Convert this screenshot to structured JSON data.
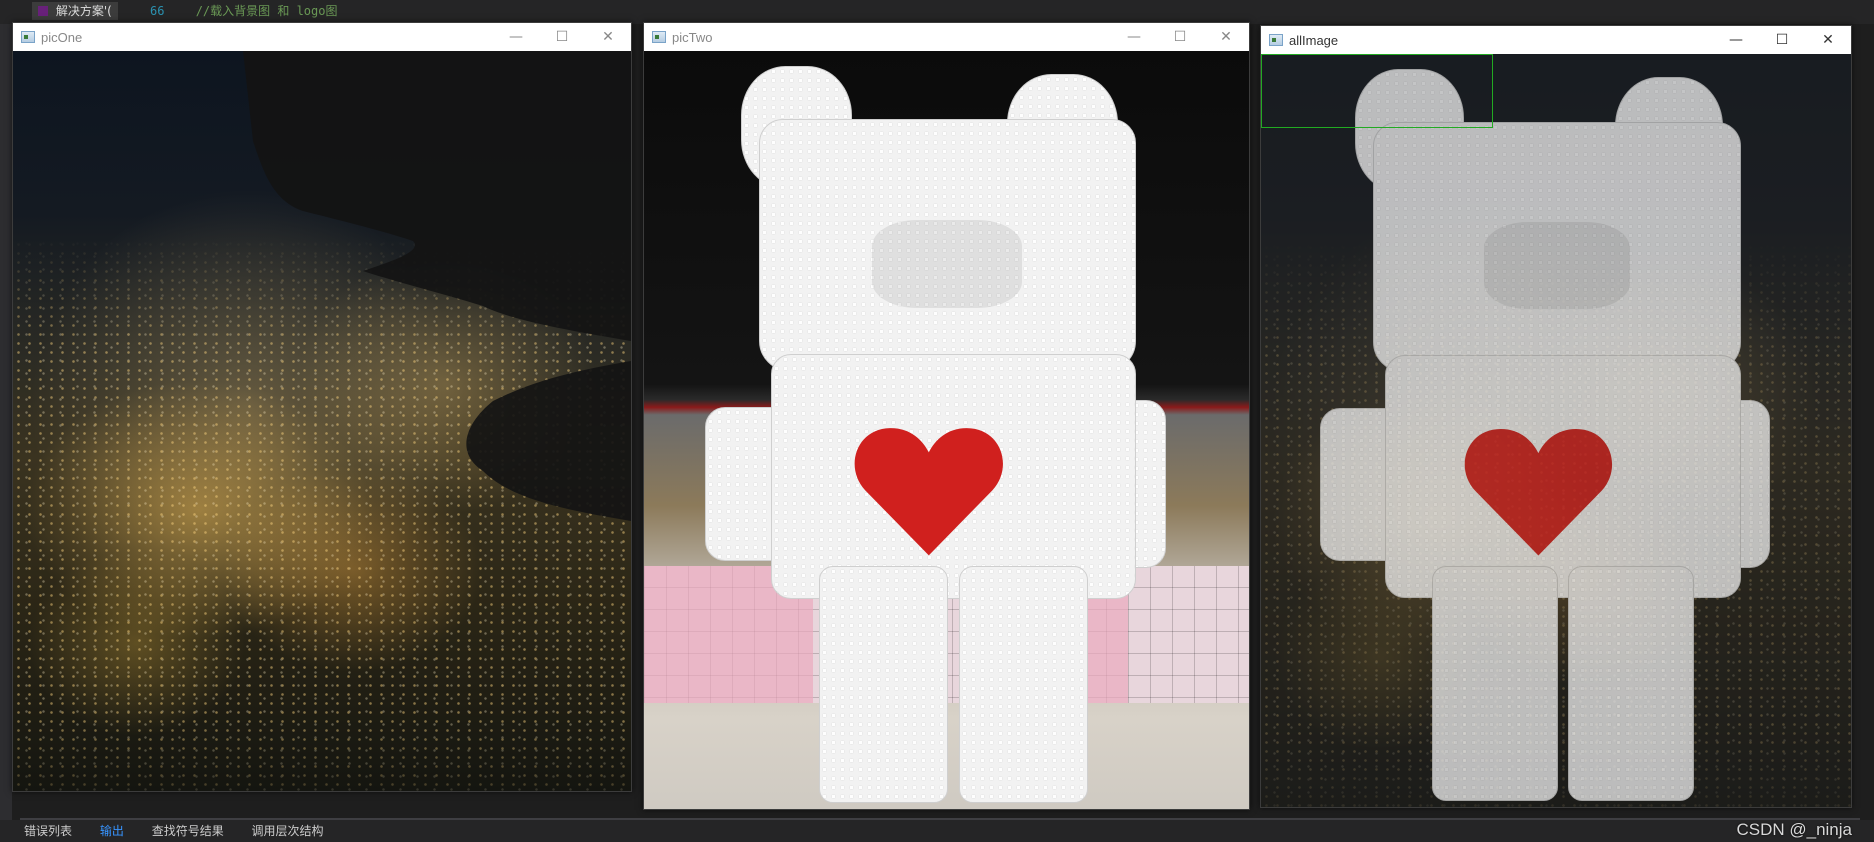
{
  "ide": {
    "tab_label": "解决方案'(",
    "line_number": "66",
    "code_comment": "//载入背景图 和 logo图",
    "bottom_tabs": [
      "错误列表",
      "输出",
      "查找符号结果",
      "调用层次结构"
    ],
    "active_bottom_tab": "输出"
  },
  "windows": [
    {
      "id": "picOne",
      "title": "picOne",
      "focused": false
    },
    {
      "id": "picTwo",
      "title": "picTwo",
      "focused": false
    },
    {
      "id": "allImage",
      "title": "allImage",
      "focused": true
    }
  ],
  "controls": {
    "minimize_glyph": "—",
    "maximize_glyph": "☐",
    "close_glyph": "✕"
  },
  "colors": {
    "titlebar_bg": "#ffffff",
    "roi_border": "#22aa22",
    "heart": "#d0201e"
  },
  "watermark": "CSDN @_ninja"
}
